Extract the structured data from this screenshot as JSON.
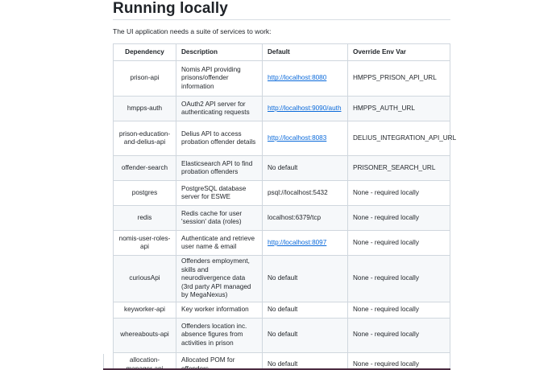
{
  "section": {
    "title": "Running locally",
    "intro": "The UI application needs a suite of services to work:"
  },
  "table": {
    "headers": {
      "dependency": "Dependency",
      "description": "Description",
      "default": "Default",
      "override": "Override Env Var"
    },
    "rows": [
      {
        "dependency": "prison-api",
        "description": "Nomis API providing prisons/offender information",
        "default": "http://localhost:8080",
        "default_is_link": true,
        "override": "HMPPS_PRISON_API_URL"
      },
      {
        "dependency": "hmpps-auth",
        "description": "OAuth2 API server for authenticating requests",
        "default": "http://localhost:9090/auth",
        "default_is_link": true,
        "override": "HMPPS_AUTH_URL"
      },
      {
        "dependency": "prison-education-and-delius-api",
        "description": "Delius API to access probation offender details",
        "default": "http://localhost:8083",
        "default_is_link": true,
        "override": "DELIUS_INTEGRATION_API_URL"
      },
      {
        "dependency": "offender-search",
        "description": "Elasticsearch API to find probation offenders",
        "default": "No default",
        "default_is_link": false,
        "override": "PRISONER_SEARCH_URL"
      },
      {
        "dependency": "postgres",
        "description": "PostgreSQL database server for ESWE",
        "default": "psql://localhost:5432",
        "default_is_link": false,
        "override": "None - required locally"
      },
      {
        "dependency": "redis",
        "description": "Redis cache for user 'session' data (roles)",
        "default": "localhost:6379/tcp",
        "default_is_link": false,
        "override": "None - required locally"
      },
      {
        "dependency": "nomis-user-roles-api",
        "description": "Authenticate and retrieve user name & email",
        "default": "http://localhost:8097",
        "default_is_link": true,
        "override": "None - required locally"
      },
      {
        "dependency": "curiousApi",
        "description": "Offenders employment, skills and neurodivergence data (3rd party API managed by MegaNexus)",
        "default": "No default",
        "default_is_link": false,
        "override": "None - required locally"
      },
      {
        "dependency": "keyworker-api",
        "description": "Key worker information",
        "default": "No default",
        "default_is_link": false,
        "override": "None - required locally"
      },
      {
        "dependency": "whereabouts-api",
        "description": "Offenders location inc. absence figures from activities in prison",
        "default": "No default",
        "default_is_link": false,
        "override": "None - required locally"
      },
      {
        "dependency": "allocation-manager-api",
        "description": "Allocated POM for offenders",
        "default": "No default",
        "default_is_link": false,
        "override": "None - required locally"
      }
    ]
  }
}
